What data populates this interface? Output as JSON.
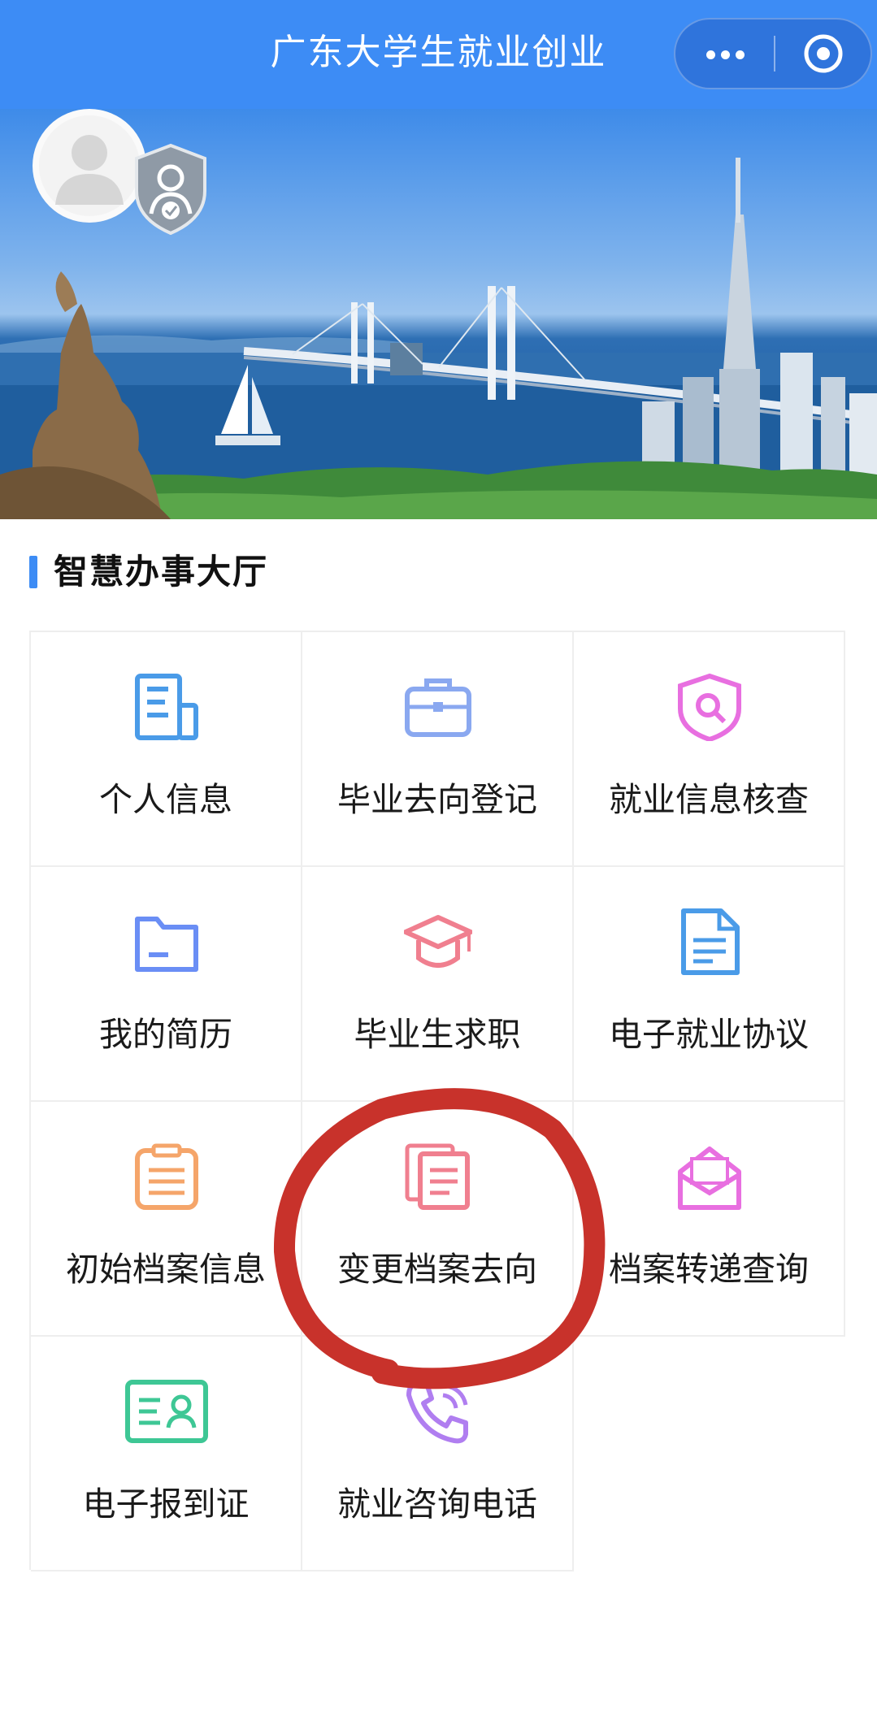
{
  "header": {
    "title": "广东大学生就业创业",
    "more_icon": "more-dots-icon",
    "close_icon": "target-close-icon",
    "color": "#3d8cf5"
  },
  "banner": {
    "avatar_icon": "default-avatar-icon",
    "badge_icon": "verified-user-badge-icon"
  },
  "section": {
    "title": "智慧办事大厅",
    "accent": "#3d8cf5"
  },
  "services": [
    {
      "label": "个人信息",
      "icon": "document-info-icon",
      "color": "#4a9be8"
    },
    {
      "label": "毕业去向登记",
      "icon": "briefcase-icon",
      "color": "#8aa8f0"
    },
    {
      "label": "就业信息核查",
      "icon": "shield-search-icon",
      "color": "#e86fe0"
    },
    {
      "label": "我的简历",
      "icon": "folder-icon",
      "color": "#6a8ef5"
    },
    {
      "label": "毕业生求职",
      "icon": "graduation-cap-icon",
      "color": "#f07f8f"
    },
    {
      "label": "电子就业协议",
      "icon": "file-text-icon",
      "color": "#4a9be8"
    },
    {
      "label": "初始档案信息",
      "icon": "clipboard-list-icon",
      "color": "#f5a56a"
    },
    {
      "label": "变更档案去向",
      "icon": "copy-documents-icon",
      "color": "#f07f8f"
    },
    {
      "label": "档案转递查询",
      "icon": "envelope-letter-icon",
      "color": "#e86fe0"
    },
    {
      "label": "电子报到证",
      "icon": "id-card-icon",
      "color": "#3ec795"
    },
    {
      "label": "就业咨询电话",
      "icon": "phone-call-icon",
      "color": "#b07ef0"
    }
  ],
  "annotation": {
    "color": "#c8322b",
    "highlighted": "变更档案去向"
  }
}
